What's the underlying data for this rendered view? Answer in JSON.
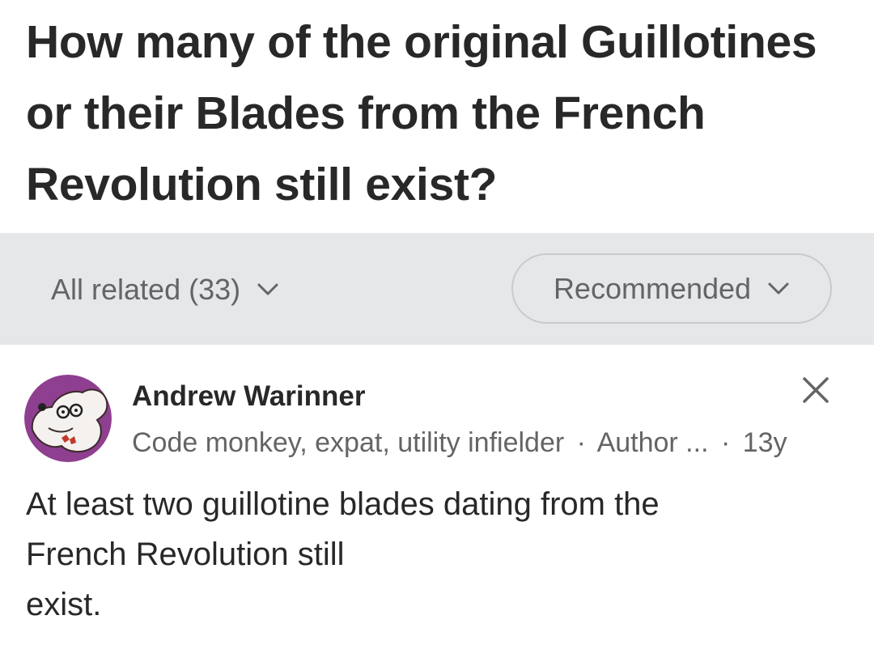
{
  "question": {
    "title": "How many of the original Guillotines or their Blades from the French Revolution still exist?"
  },
  "filter_bar": {
    "all_related_label": "All related (33)",
    "sort_label": "Recommended"
  },
  "answer": {
    "author_name": "Andrew Warinner",
    "credential": "Code monkey, expat, utility infielder",
    "separator": "·",
    "author_tag": "Author ...",
    "age": "13y",
    "text_line1": "At least two guillotine blades dating from the",
    "text_line2": "French Revolution still",
    "text_line3": "exist."
  },
  "icons": {
    "all_related_chevron": "chevron-down-icon",
    "sort_chevron": "chevron-down-icon",
    "dismiss": "close-icon",
    "avatar": "avatar-image"
  },
  "colors": {
    "text_primary": "#282829",
    "text_secondary": "#636466",
    "filter_bar_bg": "#e6e7e8",
    "pill_border": "#c9cacc",
    "avatar_bg": "#8e3f8f"
  }
}
